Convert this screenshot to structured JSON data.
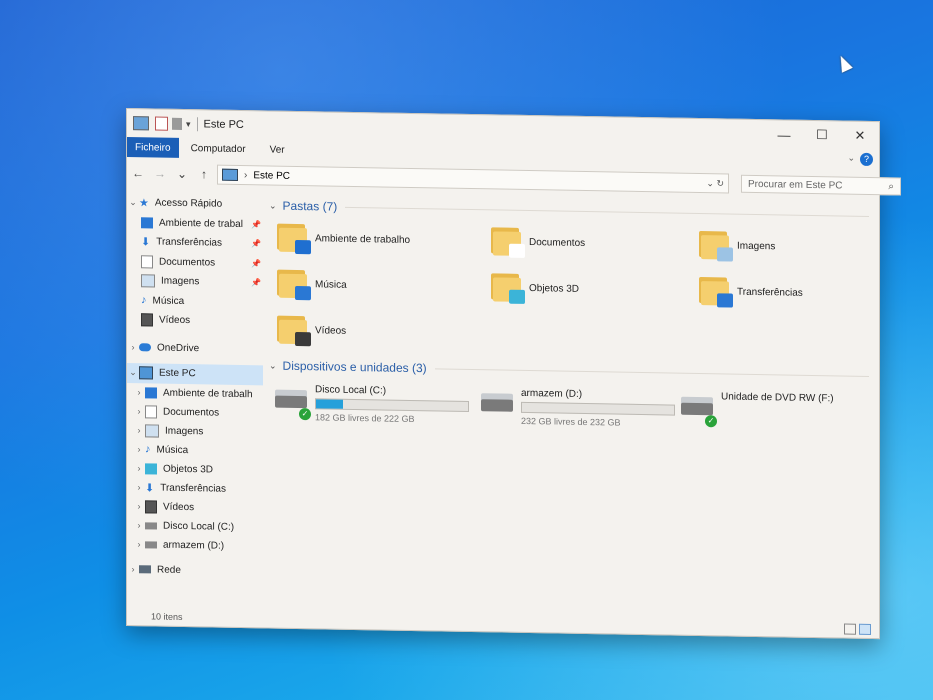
{
  "window": {
    "title": "Este PC",
    "controls": {
      "minimize": "—",
      "maximize": "☐",
      "close": "✕"
    }
  },
  "ribbon": {
    "tabs": [
      {
        "label": "Ficheiro"
      },
      {
        "label": "Computador"
      },
      {
        "label": "Ver"
      }
    ],
    "help_icon": "?"
  },
  "navigation": {
    "back_icon": "←",
    "forward_icon": "→",
    "recent_icon": "⌄",
    "up_icon": "↑",
    "address": "Este PC",
    "search_placeholder": "Procurar em Este PC"
  },
  "sidebar": {
    "quick_access": {
      "label": "Acesso Rápido",
      "items": [
        {
          "label": "Ambiente de trabal",
          "icon": "desktop-icon"
        },
        {
          "label": "Transferências",
          "icon": "download-icon"
        },
        {
          "label": "Documentos",
          "icon": "documents-icon"
        },
        {
          "label": "Imagens",
          "icon": "pictures-icon"
        },
        {
          "label": "Música",
          "icon": "music-icon"
        },
        {
          "label": "Vídeos",
          "icon": "videos-icon"
        }
      ]
    },
    "onedrive": {
      "label": "OneDrive"
    },
    "this_pc": {
      "label": "Este PC",
      "items": [
        {
          "label": "Ambiente de trabalh",
          "icon": "desktop-icon"
        },
        {
          "label": "Documentos",
          "icon": "documents-icon"
        },
        {
          "label": "Imagens",
          "icon": "pictures-icon"
        },
        {
          "label": "Música",
          "icon": "music-icon"
        },
        {
          "label": "Objetos 3D",
          "icon": "cube-icon"
        },
        {
          "label": "Transferências",
          "icon": "download-icon"
        },
        {
          "label": "Vídeos",
          "icon": "videos-icon"
        },
        {
          "label": "Disco Local (C:)",
          "icon": "drive-icon"
        },
        {
          "label": "armazem (D:)",
          "icon": "drive-icon"
        }
      ]
    },
    "network": {
      "label": "Rede"
    }
  },
  "main": {
    "folders_group": {
      "title": "Pastas (7)",
      "items": [
        {
          "label": "Ambiente de trabalho",
          "badge_color": "#1f6fd0"
        },
        {
          "label": "Documentos",
          "badge_color": "#ffffff"
        },
        {
          "label": "Imagens",
          "badge_color": "#9cc3e4"
        },
        {
          "label": "Música",
          "badge_color": "#2a78d4"
        },
        {
          "label": "Objetos 3D",
          "badge_color": "#3bb4d8"
        },
        {
          "label": "Transferências",
          "badge_color": "#2a78d4"
        },
        {
          "label": "Vídeos",
          "badge_color": "#3a3a3a"
        }
      ]
    },
    "drives_group": {
      "title": "Dispositivos e unidades (3)",
      "items": [
        {
          "label": "Disco Local (C:)",
          "free": "182 GB livres de 222 GB",
          "used_fraction": 0.18,
          "has_check": true,
          "show_bar": true
        },
        {
          "label": "armazem (D:)",
          "free": "232 GB livres de 232 GB",
          "used_fraction": 0.0,
          "has_check": false,
          "show_bar": true
        },
        {
          "label": "Unidade de DVD RW (F:)",
          "free": "",
          "used_fraction": 0.0,
          "has_check": true,
          "show_bar": false
        }
      ]
    }
  },
  "status": {
    "item_count": "10 itens"
  }
}
